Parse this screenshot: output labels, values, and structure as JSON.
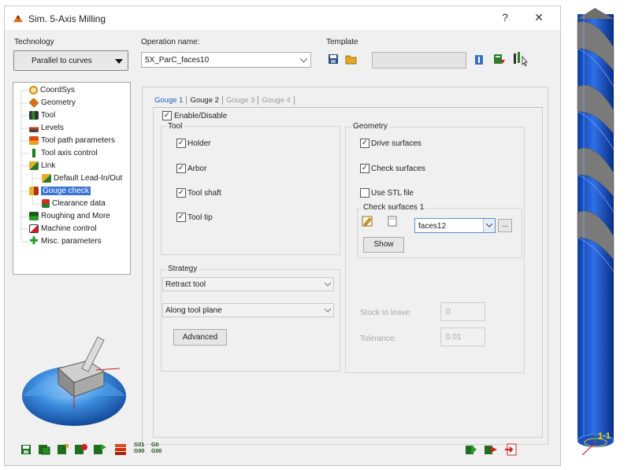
{
  "window": {
    "title": "Sim. 5-Axis Milling",
    "help": "?",
    "close": "✕"
  },
  "technology": {
    "label": "Technology",
    "value": "Parallel to curves"
  },
  "operation": {
    "label": "Operation name:",
    "value": "5X_ParC_faces10"
  },
  "template": {
    "label": "Template"
  },
  "tree": {
    "items": [
      {
        "label": "CoordSys",
        "icon": "coordsys-icon"
      },
      {
        "label": "Geometry",
        "icon": "geometry-icon"
      },
      {
        "label": "Tool",
        "icon": "tool-icon"
      },
      {
        "label": "Levels",
        "icon": "levels-icon"
      },
      {
        "label": "Tool path parameters",
        "icon": "toolpath-icon"
      },
      {
        "label": "Tool axis control",
        "icon": "tool-axis-icon"
      },
      {
        "label": "Link",
        "icon": "link-icon"
      },
      {
        "label": "Default Lead-In/Out",
        "icon": "lead-in-out-icon"
      },
      {
        "label": "Gouge check",
        "icon": "gouge-check-icon",
        "selected": true
      },
      {
        "label": "Clearance data",
        "icon": "clearance-icon"
      },
      {
        "label": "Roughing and More",
        "icon": "roughing-icon"
      },
      {
        "label": "Machine control",
        "icon": "machine-control-icon"
      },
      {
        "label": "Misc. parameters",
        "icon": "misc-icon"
      }
    ]
  },
  "tabs": [
    {
      "label": "Gouge 1",
      "active": true
    },
    {
      "label": "Gouge 2",
      "active": false
    },
    {
      "label": "Gouge 3",
      "active": false
    },
    {
      "label": "Gouge 4",
      "active": false
    }
  ],
  "enable": {
    "label": "Enable/Disable",
    "checked": true
  },
  "tool_group": {
    "title": "Tool",
    "items": [
      {
        "label": "Holder",
        "checked": true
      },
      {
        "label": "Arbor",
        "checked": true
      },
      {
        "label": "Tool shaft",
        "checked": true
      },
      {
        "label": "Tool tip",
        "checked": true
      }
    ]
  },
  "geometry_group": {
    "title": "Geometry",
    "items": [
      {
        "label": "Drive surfaces",
        "checked": true
      },
      {
        "label": "Check surfaces",
        "checked": true
      },
      {
        "label": "Use STL file",
        "checked": false
      }
    ]
  },
  "check_surfaces": {
    "title": "Check surfaces 1",
    "value": "faces12",
    "more": "...",
    "show": "Show"
  },
  "strategy": {
    "title": "Strategy",
    "retract": "Retract tool",
    "along": "Along tool plane",
    "advanced": "Advanced"
  },
  "stock": {
    "label": "Stock to leave:",
    "value": "0"
  },
  "tolerance": {
    "label": "Tolerance:",
    "value": "0.01"
  },
  "bottom_toolbar": {
    "gcode_a": "G01",
    "gcode_b": "G00",
    "gcode_c": "G0",
    "gcode_d": "G00"
  },
  "cad_view": {
    "label": "1-1"
  },
  "colors": {
    "accent": "#0b5fc4",
    "selected": "#3874d8",
    "drill_blue": "#1f5fd1"
  }
}
